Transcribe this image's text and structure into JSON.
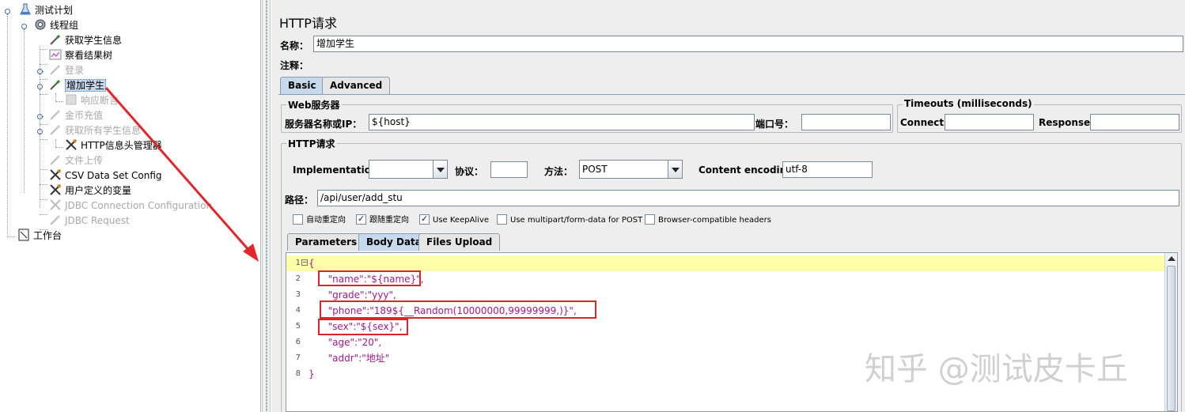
{
  "tree": {
    "items": [
      {
        "label": "测试计划",
        "icon": "test-plan-icon",
        "disabled": false
      },
      {
        "label": "线程组",
        "icon": "thread-group-gear-icon",
        "disabled": false
      },
      {
        "label": "获取学生信息",
        "icon": "sampler-pipette-icon",
        "disabled": false
      },
      {
        "label": "察看结果树",
        "icon": "result-tree-chart-icon",
        "disabled": false
      },
      {
        "label": "登录",
        "icon": "sampler-pipette-icon",
        "disabled": true
      },
      {
        "label": "增加学生",
        "icon": "sampler-pipette-icon",
        "disabled": false,
        "selected": true
      },
      {
        "label": "响应断言",
        "icon": "assertion-icon",
        "disabled": true
      },
      {
        "label": "金币充值",
        "icon": "sampler-pipette-icon",
        "disabled": true
      },
      {
        "label": "获取所有学生信息",
        "icon": "sampler-pipette-icon",
        "disabled": true
      },
      {
        "label": "HTTP信息头管理器",
        "icon": "config-wrench-icon",
        "disabled": false
      },
      {
        "label": "文件上传",
        "icon": "sampler-pipette-icon",
        "disabled": true
      },
      {
        "label": "CSV Data Set Config",
        "icon": "config-wrench-icon",
        "disabled": false
      },
      {
        "label": "用户定义的变量",
        "icon": "config-wrench-icon",
        "disabled": false
      },
      {
        "label": "JDBC Connection Configuration",
        "icon": "config-wrench-icon",
        "disabled": true
      },
      {
        "label": "JDBC Request",
        "icon": "sampler-pipette-icon",
        "disabled": true
      },
      {
        "label": "工作台",
        "icon": "workbench-icon",
        "disabled": false
      }
    ]
  },
  "panel": {
    "title": "HTTP请求",
    "name_label": "名称：",
    "name_value": "增加学生",
    "comment_label": "注释：",
    "comment_value": "",
    "tabs": {
      "basic": "Basic",
      "advanced": "Advanced"
    },
    "web_server": {
      "group_title": "Web服务器",
      "host_label": "服务器名称或IP：",
      "host_value": "${host}",
      "port_label": "端口号：",
      "port_value": ""
    },
    "timeouts": {
      "group_title": "Timeouts (milliseconds)",
      "connect_label": "Connect:",
      "connect_value": "",
      "response_label": "Response:",
      "response_value": ""
    },
    "http_request": {
      "group_title": "HTTP请求",
      "implementation_label": "Implementation:",
      "implementation_value": "",
      "protocol_label": "协议：",
      "protocol_value": "",
      "method_label": "方法：",
      "method_value": "POST",
      "encoding_label": "Content encoding:",
      "encoding_value": "utf-8",
      "path_label": "路径：",
      "path_value": "/api/user/add_stu"
    },
    "checkboxes": [
      {
        "label": "自动重定向",
        "checked": false
      },
      {
        "label": "跟随重定向",
        "checked": true
      },
      {
        "label": "Use KeepAlive",
        "checked": true
      },
      {
        "label": "Use multipart/form-data for POST",
        "checked": false
      },
      {
        "label": "Browser-compatible headers",
        "checked": false
      }
    ],
    "sub_tabs": {
      "parameters": "Parameters",
      "body_data": "Body Data",
      "files_upload": "Files Upload"
    },
    "body_lines": [
      {
        "num": "1",
        "text": "{"
      },
      {
        "num": "2",
        "text": "  \"name\":\"${name}\","
      },
      {
        "num": "3",
        "text": "  \"grade\":\"yyy\","
      },
      {
        "num": "4",
        "text": "  \"phone\":\"189${__Random(10000000,99999999,)}\","
      },
      {
        "num": "5",
        "text": "  \"sex\":\"${sex}\","
      },
      {
        "num": "6",
        "text": "  \"age\":\"20\","
      },
      {
        "num": "7",
        "text": "  \"addr\":\"地址\""
      },
      {
        "num": "8",
        "text": "}"
      }
    ]
  },
  "watermark": "知乎 @测试皮卡丘",
  "colors": {
    "highlight_box": "#d9262c",
    "current_line": "#ffffaa",
    "selected_tab": "#c7d9ec"
  }
}
